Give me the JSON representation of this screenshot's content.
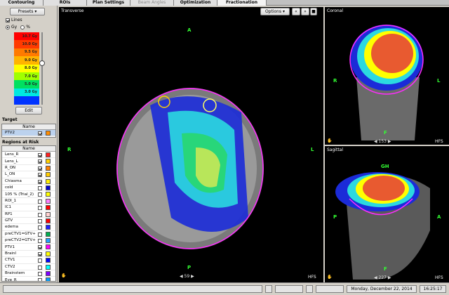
{
  "tabs": [
    "Contouring",
    "ROIs",
    "Plan Settings",
    "Beam Angles",
    "Optimization",
    "Fractionation"
  ],
  "sidebar": {
    "presets_label": "Presets",
    "lines_label": "Lines",
    "unit_gy": "Gy",
    "unit_pct": "%",
    "doses": [
      {
        "label": "10.7 Gy",
        "color": "#ff0000"
      },
      {
        "label": "10.0 Gy",
        "color": "#ff3a00"
      },
      {
        "label": "9.5 Gy",
        "color": "#ff7a00"
      },
      {
        "label": "9.0 Gy",
        "color": "#ffb400"
      },
      {
        "label": "8.0 Gy",
        "color": "#ffff00"
      },
      {
        "label": "7.0 Gy",
        "color": "#a0ff00"
      },
      {
        "label": "5.0 Gy",
        "color": "#00e060"
      },
      {
        "label": "3.0 Gy",
        "color": "#00e8e0"
      },
      {
        "label": "",
        "color": "#0033ff"
      }
    ],
    "edit_label": "Edit",
    "target_title": "Target",
    "target_col": "Name",
    "target_row": {
      "name": "PTV2",
      "color": "#ff8c00"
    },
    "roi_title": "Regions at Risk",
    "roi_col": "Name",
    "rois": [
      {
        "name": "Lens_R",
        "checked": true,
        "color": "#ff2020"
      },
      {
        "name": "Lens_L",
        "checked": true,
        "color": "#ffd000"
      },
      {
        "name": "R_ON",
        "checked": true,
        "color": "#ff8000"
      },
      {
        "name": "L_ON",
        "checked": true,
        "color": "#ffcc00"
      },
      {
        "name": "Chiasma",
        "checked": true,
        "color": "#ffee00"
      },
      {
        "name": "cold",
        "checked": false,
        "color": "#0000cc"
      },
      {
        "name": "105 % (Trial_2)",
        "checked": false,
        "color": "#ffff00"
      },
      {
        "name": "ROI_1",
        "checked": false,
        "color": "#ff80ff"
      },
      {
        "name": "IC1",
        "checked": false,
        "color": "#ff0000"
      },
      {
        "name": "RP1",
        "checked": false,
        "color": "#ffd0d0"
      },
      {
        "name": "GTV",
        "checked": false,
        "color": "#ff0000"
      },
      {
        "name": "edema",
        "checked": false,
        "color": "#2020ff"
      },
      {
        "name": "preCTV1=GTV+...",
        "checked": false,
        "color": "#00b050"
      },
      {
        "name": "preCTV2=GTV+...",
        "checked": false,
        "color": "#20a0ff"
      },
      {
        "name": "PTV1",
        "checked": true,
        "color": "#ff00ff"
      },
      {
        "name": "BrainI",
        "checked": true,
        "color": "#ffff00"
      },
      {
        "name": "CTV1",
        "checked": false,
        "color": "#0000ff"
      },
      {
        "name": "CTV2",
        "checked": false,
        "color": "#00ffff"
      },
      {
        "name": "Brainstem",
        "checked": false,
        "color": "#8000ff"
      },
      {
        "name": "Eye_R",
        "checked": false,
        "color": "#00a0ff"
      }
    ]
  },
  "transverse": {
    "title": "Transverse",
    "options_label": "Options",
    "top": "A",
    "bottom": "P",
    "left": "R",
    "right": "L",
    "slice": "59",
    "orient": "HFS"
  },
  "coronal": {
    "title": "Coronal",
    "left": "R",
    "right": "L",
    "bottom": "F",
    "slice": "153",
    "orient": "HFS"
  },
  "sagittal": {
    "title": "Sagittal",
    "top": "GH",
    "left": "P",
    "right": "A",
    "bottom": "F",
    "slice": "227",
    "orient": "HFS"
  },
  "status": {
    "date": "Monday, December 22, 2014",
    "time": "16:25:17"
  }
}
